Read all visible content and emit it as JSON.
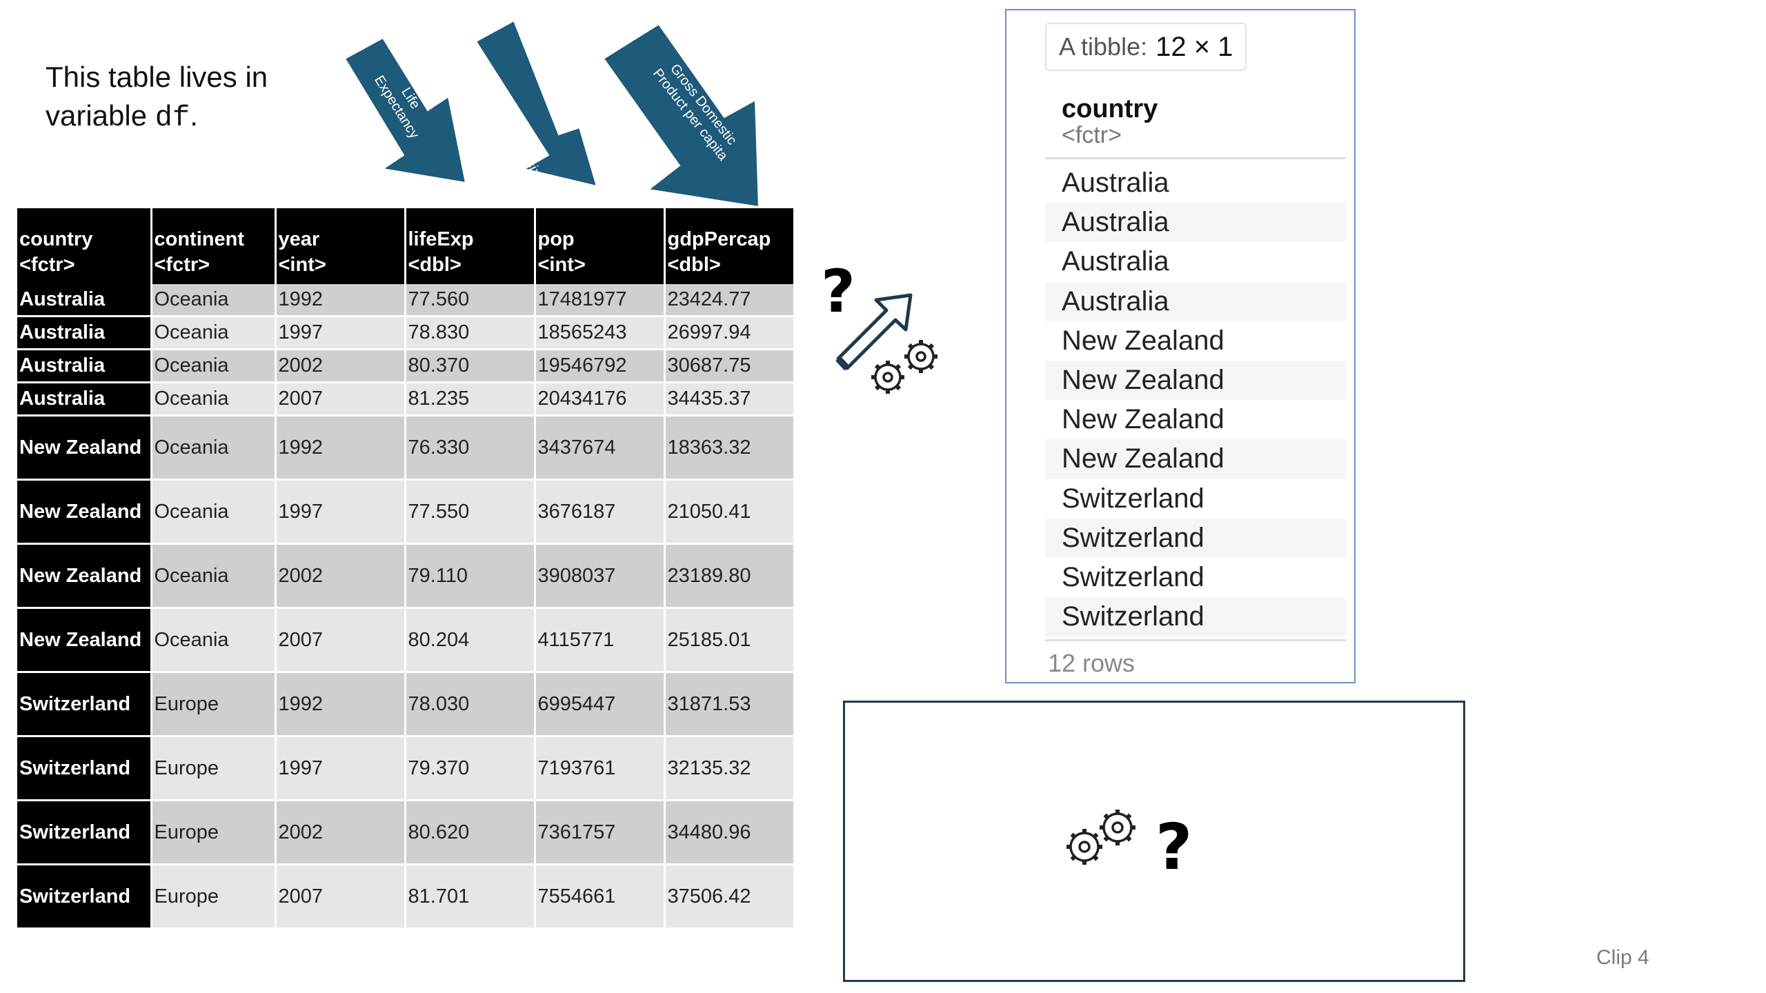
{
  "intro": {
    "line1": "This table lives in",
    "line2_prefix": "variable ",
    "line2_code": "df",
    "line2_suffix": "."
  },
  "annotations": {
    "life_exp": "Life\nExpectancy",
    "pop": "Population size",
    "gdp": "Gross Domestic\nProduct per capita",
    "arrow_color": "#1e5a7a"
  },
  "df_table": {
    "columns": [
      {
        "name": "country",
        "type": "<fctr>"
      },
      {
        "name": "continent",
        "type": "<fctr>"
      },
      {
        "name": "year",
        "type": "<int>"
      },
      {
        "name": "lifeExp",
        "type": "<dbl>"
      },
      {
        "name": "pop",
        "type": "<int>"
      },
      {
        "name": "gdpPercap",
        "type": "<dbl>"
      }
    ],
    "rows": [
      [
        "Australia",
        "Oceania",
        "1992",
        "77.560",
        "17481977",
        "23424.77"
      ],
      [
        "Australia",
        "Oceania",
        "1997",
        "78.830",
        "18565243",
        "26997.94"
      ],
      [
        "Australia",
        "Oceania",
        "2002",
        "80.370",
        "19546792",
        "30687.75"
      ],
      [
        "Australia",
        "Oceania",
        "2007",
        "81.235",
        "20434176",
        "34435.37"
      ],
      [
        "New Zealand",
        "Oceania",
        "1992",
        "76.330",
        "3437674",
        "18363.32"
      ],
      [
        "New Zealand",
        "Oceania",
        "1997",
        "77.550",
        "3676187",
        "21050.41"
      ],
      [
        "New Zealand",
        "Oceania",
        "2002",
        "79.110",
        "3908037",
        "23189.80"
      ],
      [
        "New Zealand",
        "Oceania",
        "2007",
        "80.204",
        "4115771",
        "25185.01"
      ],
      [
        "Switzerland",
        "Europe",
        "1992",
        "78.030",
        "6995447",
        "31871.53"
      ],
      [
        "Switzerland",
        "Europe",
        "1997",
        "79.370",
        "7193761",
        "32135.32"
      ],
      [
        "Switzerland",
        "Europe",
        "2002",
        "80.620",
        "7361757",
        "34480.96"
      ],
      [
        "Switzerland",
        "Europe",
        "2007",
        "81.701",
        "7554661",
        "37506.42"
      ]
    ]
  },
  "process_icons": {
    "question_mark": "?"
  },
  "tibble": {
    "badge_label": "A tibble:",
    "badge_dims": "12 × 1",
    "column_name": "country",
    "column_type": "<fctr>",
    "rows": [
      "Australia",
      "Australia",
      "Australia",
      "Australia",
      "New Zealand",
      "New Zealand",
      "New Zealand",
      "New Zealand",
      "Switzerland",
      "Switzerland",
      "Switzerland",
      "Switzerland"
    ],
    "footer": "12 rows",
    "border_color": "#6a8fc4"
  },
  "clip_label": "Clip 4"
}
